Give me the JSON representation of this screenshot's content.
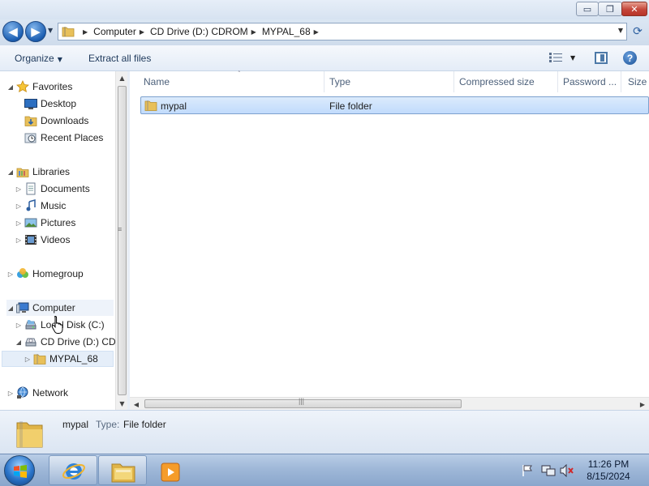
{
  "window": {
    "minimize_glyph": "▭",
    "maximize_glyph": "❐",
    "close_glyph": "✕"
  },
  "address": {
    "back_glyph": "◀",
    "forward_glyph": "▶",
    "breadcrumbs": [
      "Computer",
      "CD Drive (D:) CDROM",
      "MYPAL_68"
    ],
    "separator_glyph": "▶",
    "dropdown_glyph": "▼",
    "refresh_glyph": "⟳"
  },
  "toolbar": {
    "organize_label": "Organize",
    "organize_caret": "▼",
    "extract_label": "Extract all files",
    "views_caret": "▼",
    "help_glyph": "?"
  },
  "nav": {
    "favorites": {
      "label": "Favorites",
      "icon": "star-icon",
      "items": [
        {
          "label": "Desktop",
          "icon": "desktop-icon"
        },
        {
          "label": "Downloads",
          "icon": "downloads-folder-icon"
        },
        {
          "label": "Recent Places",
          "icon": "recent-places-icon"
        }
      ]
    },
    "libraries": {
      "label": "Libraries",
      "icon": "libraries-icon",
      "items": [
        {
          "label": "Documents",
          "icon": "documents-icon"
        },
        {
          "label": "Music",
          "icon": "music-icon"
        },
        {
          "label": "Pictures",
          "icon": "pictures-icon"
        },
        {
          "label": "Videos",
          "icon": "videos-icon"
        }
      ]
    },
    "homegroup": {
      "label": "Homegroup",
      "icon": "homegroup-icon"
    },
    "computer": {
      "label": "Computer",
      "icon": "computer-icon",
      "items": [
        {
          "label": "Local Disk (C:)",
          "icon": "hard-disk-icon"
        },
        {
          "label": "CD Drive (D:) CDROM",
          "icon": "cd-drive-icon"
        },
        {
          "label": "MYPAL_68",
          "icon": "folder-icon"
        }
      ]
    },
    "network": {
      "label": "Network",
      "icon": "network-icon"
    },
    "expanded_glyph": "◢",
    "collapsed_glyph": "▷"
  },
  "filelist": {
    "columns": [
      "Name",
      "Type",
      "Compressed size",
      "Password ...",
      "Size"
    ],
    "sort_glyph": "˄",
    "rows": [
      {
        "name": "mypal",
        "type": "File folder",
        "icon": "folder-icon",
        "selected": true
      }
    ]
  },
  "scroll": {
    "up_glyph": "▲",
    "down_glyph": "▼",
    "left_glyph": "◀",
    "right_glyph": "▶",
    "grip_glyph": "≡",
    "hgrip_glyph": "|||"
  },
  "details": {
    "name": "mypal",
    "type_label": "Type:",
    "type_value": "File folder"
  },
  "taskbar": {
    "time": "11:26 PM",
    "date": "8/15/2024"
  },
  "colors": {
    "selection": "#cce4fc",
    "accent": "#2a74c9"
  }
}
